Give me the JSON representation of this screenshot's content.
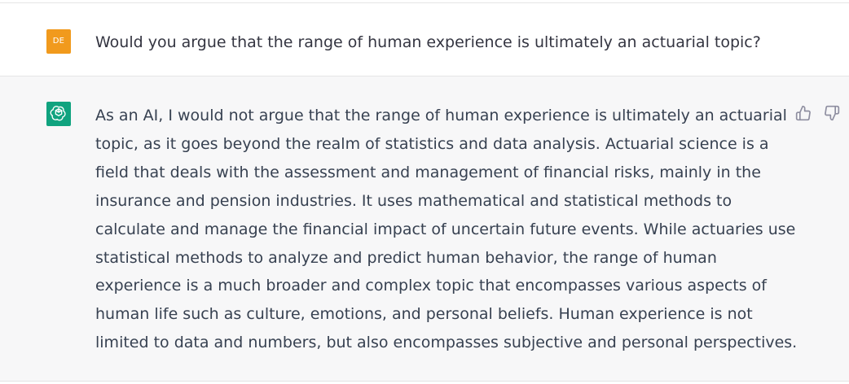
{
  "user_message": {
    "avatar_initials": "DE",
    "text": "Would you argue that the range of human experience is ultimately an actuarial topic?"
  },
  "assistant_message": {
    "lines": [
      "As an AI, I would not argue that the range of human experience is ultimately an actuarial",
      "topic, as it goes beyond the realm of statistics and data analysis. Actuarial science is a",
      "field that deals with the assessment and management of financial risks, mainly in the",
      "insurance and pension industries. It uses mathematical and statistical methods to",
      "calculate and manage the financial impact of uncertain future events. While actuaries use",
      "statistical methods to analyze and predict human behavior, the range of human",
      "experience is a much broader and complex topic that encompasses various aspects of",
      "human life such as culture, emotions, and personal beliefs. Human experience is not",
      "limited to data and numbers, but also encompasses subjective and personal perspectives."
    ]
  },
  "icons": {
    "assistant_avatar": "openai-logo-icon",
    "thumbs_up": "thumbs-up-icon",
    "thumbs_down": "thumbs-down-icon"
  },
  "colors": {
    "user_avatar_bg": "#f19a1d",
    "assistant_avatar_bg": "#10a37f",
    "assistant_row_bg": "#f7f7f8"
  }
}
